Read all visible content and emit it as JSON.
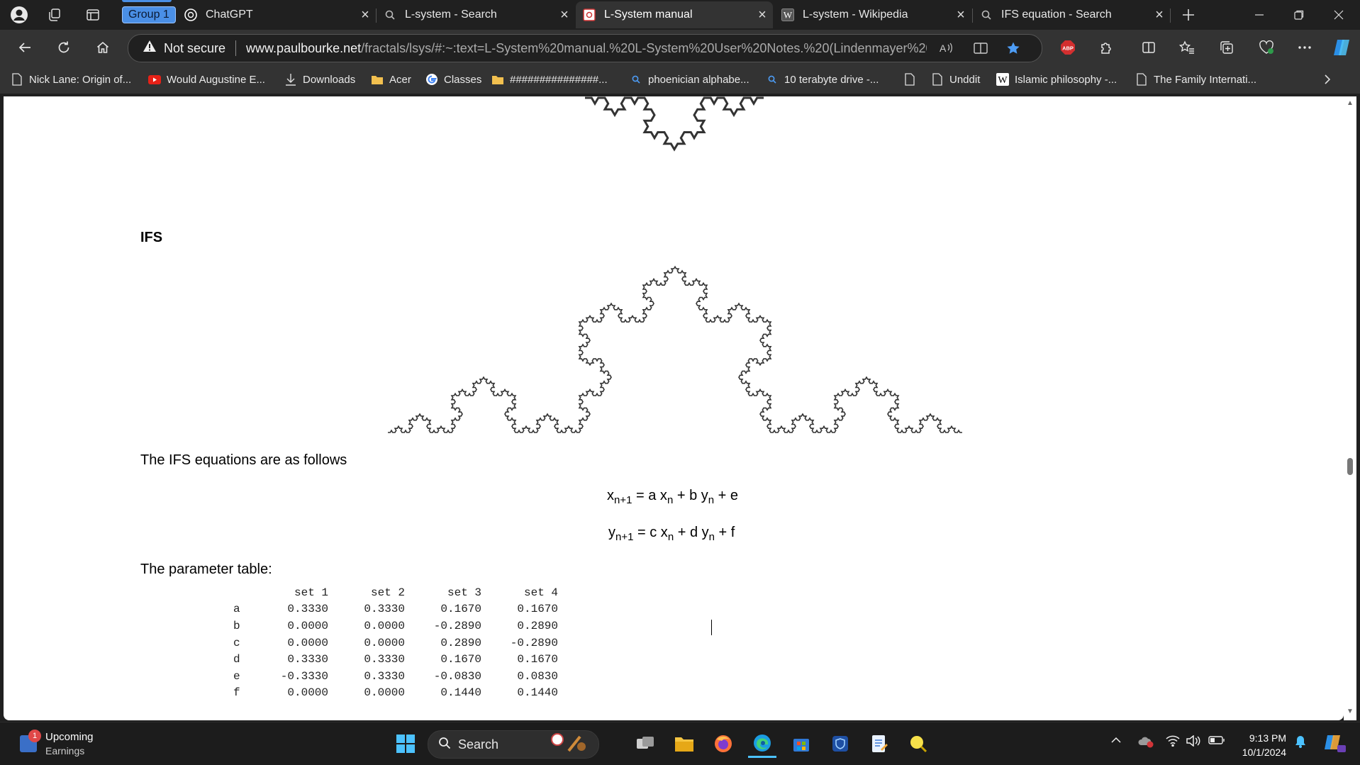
{
  "tabstrip": {
    "group_label": "Group 1",
    "tabs": [
      {
        "title": "ChatGPT",
        "icon": "chatgpt-icon"
      },
      {
        "title": "L-system - Search",
        "icon": "search-icon"
      },
      {
        "title": "L-System manual",
        "icon": "site-favicon"
      },
      {
        "title": "L-system - Wikipedia",
        "icon": "wikipedia-icon"
      },
      {
        "title": "IFS equation - Search",
        "icon": "search-icon"
      }
    ]
  },
  "toolbar": {
    "security_text": "Not secure",
    "url_host": "www.paulbourke.net",
    "url_rest": "/fractals/lsys/#:~:text=L-System%20manual.%20L-System%20User%20Notes.%20(Lindenmayer%20Sy..."
  },
  "bookmarks": [
    "Nick Lane: Origin of...",
    "Would Augustine E...",
    "Downloads",
    "Acer",
    "Classes",
    "###############...",
    "phoenician alphabe...",
    "10 terabyte drive -...",
    "Unddit",
    "Islamic philosophy -...",
    "The Family Internati..."
  ],
  "page": {
    "heading": "IFS",
    "intro": "The IFS equations are as follows",
    "eq1": {
      "lhs": "x",
      "lhs_sub": "n+1",
      "p1": " = a x",
      "s1": "n",
      "p2": " + b y",
      "s2": "n",
      "p3": " + e"
    },
    "eq2": {
      "lhs": "y",
      "lhs_sub": "n+1",
      "p1": " = c x",
      "s1": "n",
      "p2": " + d y",
      "s2": "n",
      "p3": " + f"
    },
    "param_title": "The parameter table:",
    "table": {
      "headers": [
        "set 1",
        "set 2",
        "set 3",
        "set 4"
      ],
      "rows": [
        {
          "label": "a",
          "values": [
            "0.3330",
            "0.3330",
            "0.1670",
            "0.1670"
          ]
        },
        {
          "label": "b",
          "values": [
            "0.0000",
            "0.0000",
            "-0.2890",
            "0.2890"
          ]
        },
        {
          "label": "c",
          "values": [
            "0.0000",
            "0.0000",
            "0.2890",
            "-0.2890"
          ]
        },
        {
          "label": "d",
          "values": [
            "0.3330",
            "0.3330",
            "0.1670",
            "0.1670"
          ]
        },
        {
          "label": "e",
          "values": [
            "-0.3330",
            "0.3330",
            "-0.0830",
            "0.0830"
          ]
        },
        {
          "label": "f",
          "values": [
            "0.0000",
            "0.0000",
            "0.1440",
            "0.1440"
          ]
        }
      ]
    }
  },
  "taskbar": {
    "weather_title": "Upcoming",
    "weather_sub": "Earnings",
    "weather_badge": "1",
    "search_label": "Search",
    "time": "9:13 PM",
    "date": "10/1/2024"
  }
}
